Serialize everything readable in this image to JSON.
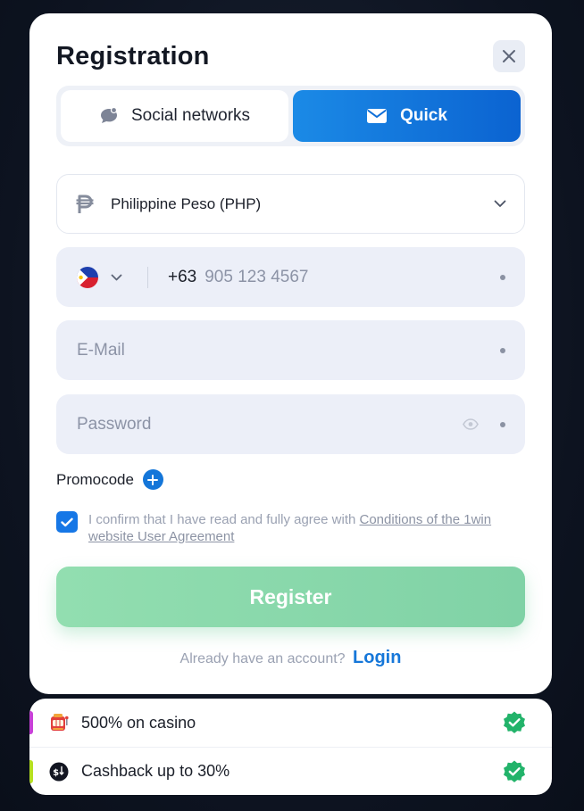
{
  "modal": {
    "title": "Registration"
  },
  "tabs": [
    {
      "label": "Social networks",
      "icon": "chat-bubble-icon",
      "active": false
    },
    {
      "label": "Quick",
      "icon": "envelope-icon",
      "active": true
    }
  ],
  "currency": {
    "label": "Philippine Peso (PHP)",
    "icon": "peso-icon"
  },
  "phone": {
    "flag": "philippines-flag-icon",
    "prefix": "+63",
    "placeholder": "905 123 4567"
  },
  "email": {
    "placeholder": "E-Mail"
  },
  "password": {
    "placeholder": "Password"
  },
  "promocode": {
    "label": "Promocode"
  },
  "agreement": {
    "checked": true,
    "text": "I confirm that I have read and fully agree with ",
    "link": "Conditions of the 1win website User Agreement"
  },
  "register": {
    "label": "Register"
  },
  "login": {
    "question": "Already have an account?",
    "link": "Login"
  },
  "bonuses": [
    {
      "text": "500% on casino",
      "icon": "slot-machine-icon",
      "accent": "#c840d8"
    },
    {
      "text": "Cashback up to 30%",
      "icon": "cashback-icon",
      "accent": "#b6e020"
    }
  ],
  "colors": {
    "primary": "#1677e6",
    "register": "#8ad9ac",
    "success": "#22b36a"
  }
}
